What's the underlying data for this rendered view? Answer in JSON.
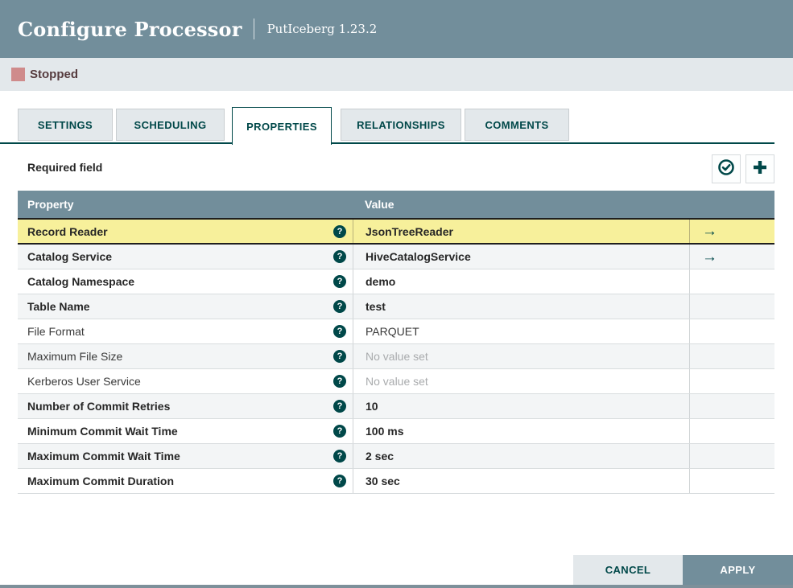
{
  "header": {
    "title": "Configure Processor",
    "subtitle": "PutIceberg 1.23.2"
  },
  "status": {
    "label": "Stopped"
  },
  "tabs": [
    {
      "label": "SETTINGS",
      "active": false
    },
    {
      "label": "SCHEDULING",
      "active": false
    },
    {
      "label": "PROPERTIES",
      "active": true
    },
    {
      "label": "RELATIONSHIPS",
      "active": false
    },
    {
      "label": "COMMENTS",
      "active": false
    }
  ],
  "toolbar": {
    "required_label": "Required field"
  },
  "icons": {
    "help": "?",
    "goto_arrow": "→"
  },
  "table": {
    "columns": {
      "property": "Property",
      "value": "Value"
    },
    "rows": [
      {
        "property": "Record Reader",
        "value": "JsonTreeReader",
        "required": true,
        "selected": true,
        "has_arrow": true,
        "unset": false
      },
      {
        "property": "Catalog Service",
        "value": "HiveCatalogService",
        "required": true,
        "selected": false,
        "has_arrow": true,
        "unset": false
      },
      {
        "property": "Catalog Namespace",
        "value": "demo",
        "required": true,
        "selected": false,
        "has_arrow": false,
        "unset": false
      },
      {
        "property": "Table Name",
        "value": "test",
        "required": true,
        "selected": false,
        "has_arrow": false,
        "unset": false
      },
      {
        "property": "File Format",
        "value": "PARQUET",
        "required": false,
        "selected": false,
        "has_arrow": false,
        "unset": false
      },
      {
        "property": "Maximum File Size",
        "value": "No value set",
        "required": false,
        "selected": false,
        "has_arrow": false,
        "unset": true
      },
      {
        "property": "Kerberos User Service",
        "value": "No value set",
        "required": false,
        "selected": false,
        "has_arrow": false,
        "unset": true
      },
      {
        "property": "Number of Commit Retries",
        "value": "10",
        "required": true,
        "selected": false,
        "has_arrow": false,
        "unset": false
      },
      {
        "property": "Minimum Commit Wait Time",
        "value": "100 ms",
        "required": true,
        "selected": false,
        "has_arrow": false,
        "unset": false
      },
      {
        "property": "Maximum Commit Wait Time",
        "value": "2 sec",
        "required": true,
        "selected": false,
        "has_arrow": false,
        "unset": false
      },
      {
        "property": "Maximum Commit Duration",
        "value": "30 sec",
        "required": true,
        "selected": false,
        "has_arrow": false,
        "unset": false
      }
    ]
  },
  "footer": {
    "cancel_label": "CANCEL",
    "apply_label": "APPLY"
  },
  "colors": {
    "header_bg": "#728e9b",
    "accent": "#004849",
    "selected_row_bg": "#f7f09b",
    "status_stopped_swatch": "#cf8b8b",
    "status_text": "#563b3e",
    "row_alt_bg": "#f3f5f6"
  }
}
